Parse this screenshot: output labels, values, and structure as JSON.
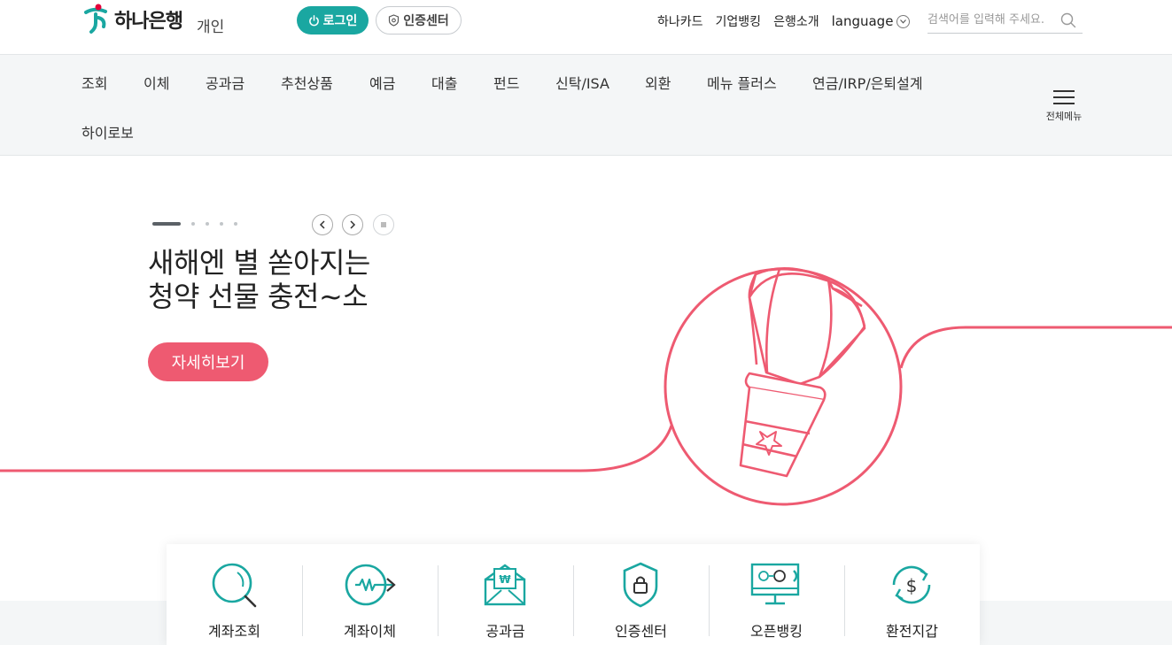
{
  "header": {
    "logo_text": "하나은행",
    "logo_sub": "개인",
    "login_label": "로그인",
    "cert_label": "인증센터",
    "links": [
      "하나카드",
      "기업뱅킹",
      "은행소개"
    ],
    "language_label": "language",
    "search_placeholder": "검색어를 입력해 주세요."
  },
  "nav": {
    "items": [
      "조회",
      "이체",
      "공과금",
      "추천상품",
      "예금",
      "대출",
      "펀드",
      "신탁/ISA",
      "외환",
      "메뉴 플러스",
      "연금/IRP/은퇴설계",
      "하이로보"
    ],
    "all_menu_label": "전체메뉴"
  },
  "hero": {
    "title_line1": "새해엔 별 쏟아지는",
    "title_line2": "청약 선물 충전~소",
    "button_label": "자세히보기",
    "slide_count": 5,
    "active_slide": 1
  },
  "quick_menu": [
    {
      "label": "계좌조회",
      "icon": "magnifier-icon"
    },
    {
      "label": "계좌이체",
      "icon": "transfer-icon"
    },
    {
      "label": "공과금",
      "icon": "bill-envelope-icon"
    },
    {
      "label": "인증센터",
      "icon": "shield-lock-icon"
    },
    {
      "label": "오픈뱅킹",
      "icon": "monitor-globe-icon"
    },
    {
      "label": "환전지갑",
      "icon": "currency-exchange-icon"
    }
  ],
  "colors": {
    "brand_teal": "#1aa7a1",
    "accent_pink": "#ee5a71",
    "nav_bg": "#f4f6f7"
  }
}
